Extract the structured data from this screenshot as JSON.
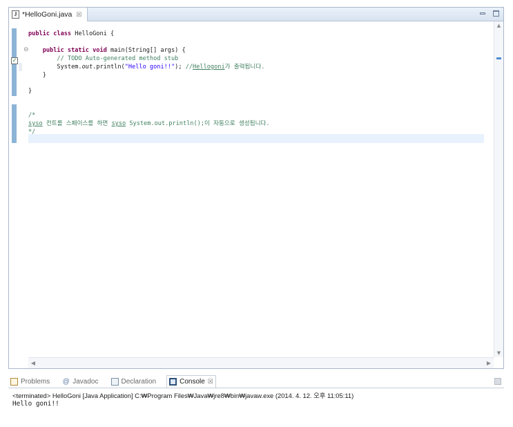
{
  "editor": {
    "tab_title": "*HelloGoni.java",
    "tab_close_glyph": "☒",
    "code_lines": [
      {
        "segments": [
          {
            "t": "public class ",
            "c": "kw"
          },
          {
            "t": "HelloGoni {",
            "c": ""
          }
        ]
      },
      {
        "segments": [
          {
            "t": "    public static void ",
            "c": "kw"
          },
          {
            "t": "main(String[] args) {",
            "c": ""
          }
        ]
      },
      {
        "segments": [
          {
            "t": "        // TODO Auto-generated method stub",
            "c": "cm"
          }
        ]
      },
      {
        "segments": [
          {
            "t": "        System.",
            "c": ""
          },
          {
            "t": "out",
            "c": "it"
          },
          {
            "t": ".println(",
            "c": ""
          },
          {
            "t": "\"Hello goni!!\"",
            "c": "str"
          },
          {
            "t": "); ",
            "c": ""
          },
          {
            "t": "//",
            "c": "cm"
          },
          {
            "t": "Hellogoni",
            "c": "cm ul"
          },
          {
            "t": "가 출력됩니다.",
            "c": "cm"
          }
        ]
      },
      {
        "segments": [
          {
            "t": "    }",
            "c": ""
          }
        ]
      },
      {
        "segments": [
          {
            "t": "}",
            "c": ""
          }
        ]
      },
      {
        "segments": [
          {
            "t": "/*",
            "c": "cm"
          }
        ]
      },
      {
        "segments": [
          {
            "t": "syso",
            "c": "cm ul"
          },
          {
            "t": " 컨트롤 스페이스를 하면 ",
            "c": "cm"
          },
          {
            "t": "syso",
            "c": "cm ul"
          },
          {
            "t": " System.out.println();이 자동으로 생성됩니다.",
            "c": "cm"
          }
        ]
      },
      {
        "segments": [
          {
            "t": "*/",
            "c": "cm"
          }
        ]
      }
    ]
  },
  "views": {
    "tabs": [
      {
        "label": "Problems",
        "icon": "problems-icon",
        "active": false
      },
      {
        "label": "Javadoc",
        "icon": "javadoc-icon",
        "active": false
      },
      {
        "label": "Declaration",
        "icon": "declaration-icon",
        "active": false
      },
      {
        "label": "Console",
        "icon": "console-icon",
        "active": true
      }
    ],
    "close_glyph": "☒"
  },
  "console": {
    "status": "<terminated> HelloGoni [Java Application] C:₩Program Files₩Java₩jre8₩bin₩javaw.exe (2014. 4. 12. 오후 11:05:11)",
    "output": "Hello goni!!"
  },
  "colors": {
    "keyword": "#7f0055",
    "comment": "#3f7f5f",
    "string": "#2a00ff",
    "ruler": "#8cb4d6"
  }
}
